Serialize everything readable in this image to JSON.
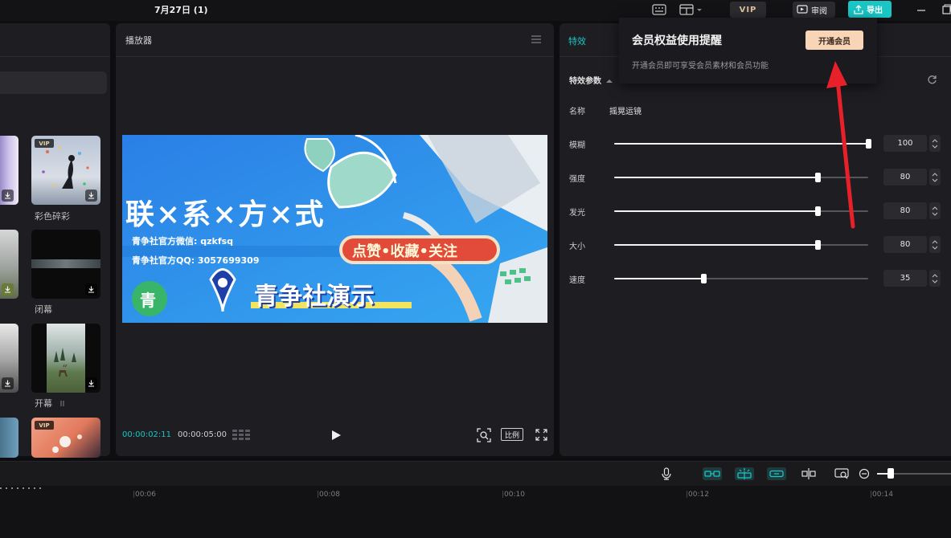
{
  "app": {
    "title": "7月27日 (1)",
    "vip_badge": "VIP",
    "review_label": "审阅",
    "export_label": "导出"
  },
  "left_panel": {
    "items": [
      {
        "label": "彩色碎彩",
        "vip": "VIP"
      },
      {
        "label": "闭幕"
      },
      {
        "label": "开幕"
      },
      {
        "label": "",
        "vip": "VIP"
      }
    ],
    "pause_glyph": "II"
  },
  "player": {
    "title": "播放器",
    "current_time": "00:00:02:11",
    "total_time": "00:00:05:00",
    "ratio_label": "比例",
    "video": {
      "heading": "联×系×方×式",
      "wechat": "青争社官方微信: qzkfsq",
      "qq": "青争社官方QQ: 3057699309",
      "badge_char": "青",
      "banner": "点赞•收藏•关注",
      "brand": "青争社演示"
    }
  },
  "effects": {
    "tab": "特效",
    "section": "特效参数",
    "name_label": "名称",
    "name_value": "摇晃运镜",
    "params": [
      {
        "label": "模糊",
        "value": 100,
        "text": "100"
      },
      {
        "label": "强度",
        "value": 80,
        "text": "80"
      },
      {
        "label": "发光",
        "value": 80,
        "text": "80"
      },
      {
        "label": "大小",
        "value": 80,
        "text": "80"
      },
      {
        "label": "速度",
        "value": 35,
        "text": "35"
      }
    ]
  },
  "popup": {
    "title": "会员权益使用提醒",
    "desc": "开通会员即可享受会员素材和会员功能",
    "button": "开通会员"
  },
  "timeline": {
    "ticks": [
      "00:06",
      "00:08",
      "00:10",
      "00:12",
      "00:14"
    ]
  },
  "colors": {
    "accent": "#19c5c5",
    "vip_button": "#f7d5b6",
    "arrow": "#e8202a"
  }
}
